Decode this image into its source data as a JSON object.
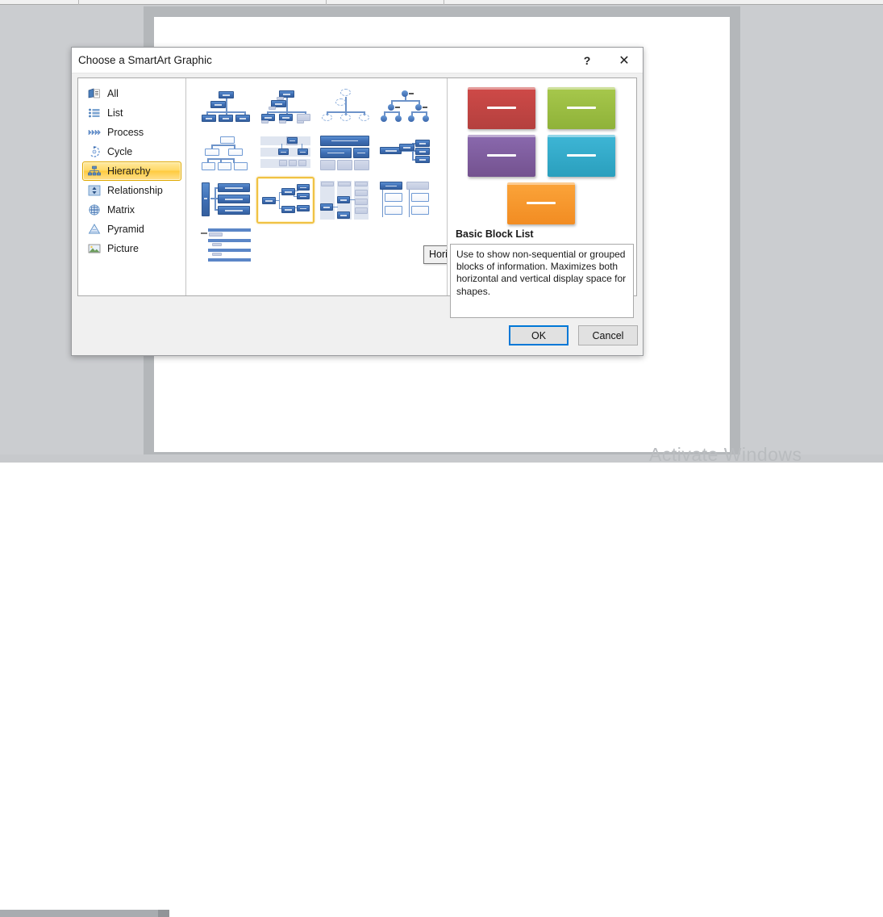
{
  "background": {
    "watermark": "Activate Windows"
  },
  "dialog": {
    "title": "Choose a SmartArt Graphic",
    "help_label": "?",
    "close_label": "✕",
    "categories": [
      {
        "label": "All",
        "icon": "all-icon",
        "selected": false
      },
      {
        "label": "List",
        "icon": "list-icon",
        "selected": false
      },
      {
        "label": "Process",
        "icon": "process-icon",
        "selected": false
      },
      {
        "label": "Cycle",
        "icon": "cycle-icon",
        "selected": false
      },
      {
        "label": "Hierarchy",
        "icon": "hierarchy-icon",
        "selected": true
      },
      {
        "label": "Relationship",
        "icon": "relationship-icon",
        "selected": false
      },
      {
        "label": "Matrix",
        "icon": "matrix-icon",
        "selected": false
      },
      {
        "label": "Pyramid",
        "icon": "pyramid-icon",
        "selected": false
      },
      {
        "label": "Picture",
        "icon": "picture-icon",
        "selected": false
      }
    ],
    "gallery": {
      "tooltip": "Horizontal Hierarchy",
      "selected_index": 9,
      "items": [
        {
          "name": "organization-chart"
        },
        {
          "name": "name-and-title-organization-chart"
        },
        {
          "name": "circle-picture-hierarchy"
        },
        {
          "name": "hierarchy-list"
        },
        {
          "name": "hierarchy"
        },
        {
          "name": "labeled-hierarchy"
        },
        {
          "name": "table-hierarchy"
        },
        {
          "name": "architecture-layout"
        },
        {
          "name": "horizontal-organization-chart"
        },
        {
          "name": "horizontal-hierarchy"
        },
        {
          "name": "horizontal-labeled-hierarchy"
        },
        {
          "name": "horizontal-multi-level-hierarchy"
        },
        {
          "name": "lined-list"
        }
      ]
    },
    "preview": {
      "caption": "Basic Block List",
      "description": "Use to show non-sequential or grouped blocks of information. Maximizes both horizontal and vertical display space for shapes.",
      "blocks": [
        {
          "name": "block-red",
          "color": "#C0504D"
        },
        {
          "name": "block-green",
          "color": "#9BBB59"
        },
        {
          "name": "block-purple",
          "color": "#8064A2"
        },
        {
          "name": "block-cyan",
          "color": "#4BACC6"
        },
        {
          "name": "block-orange",
          "color": "#F79646"
        }
      ]
    },
    "footer": {
      "ok_label": "OK",
      "cancel_label": "Cancel"
    }
  }
}
